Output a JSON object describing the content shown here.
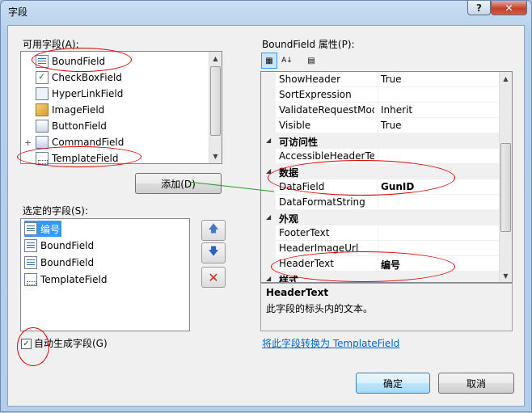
{
  "window": {
    "title": "字段",
    "help_glyph": "?",
    "close_glyph": "✕"
  },
  "available_fields": {
    "label": "可用字段(A):",
    "items": [
      {
        "label": "BoundField",
        "icon": "bound-field-icon"
      },
      {
        "label": "CheckBoxField",
        "icon": "checkbox-field-icon"
      },
      {
        "label": "HyperLinkField",
        "icon": "hyperlink-field-icon"
      },
      {
        "label": "ImageField",
        "icon": "image-field-icon"
      },
      {
        "label": "ButtonField",
        "icon": "button-field-icon"
      },
      {
        "label": "CommandField",
        "icon": "command-field-icon",
        "expand": "+"
      },
      {
        "label": "TemplateField",
        "icon": "template-field-icon"
      }
    ]
  },
  "add_button": {
    "label": "添加(D)"
  },
  "selected_fields": {
    "label": "选定的字段(S):",
    "items": [
      {
        "label": "编号",
        "icon": "bound-field-icon",
        "selected": true
      },
      {
        "label": "BoundField",
        "icon": "bound-field-icon"
      },
      {
        "label": "BoundField",
        "icon": "bound-field-icon"
      },
      {
        "label": "TemplateField",
        "icon": "template-field-icon"
      }
    ]
  },
  "move_buttons": {
    "up": "🡅",
    "down": "🡇",
    "delete": "✕"
  },
  "auto_generate": {
    "label": "自动生成字段(G)",
    "checked": true
  },
  "properties": {
    "label": "BoundField 属性(P):",
    "rows": [
      {
        "type": "prop",
        "name": "ShowHeader",
        "value": "True"
      },
      {
        "type": "prop",
        "name": "SortExpression",
        "value": ""
      },
      {
        "type": "prop",
        "name": "ValidateRequestMode",
        "value": "Inherit"
      },
      {
        "type": "prop",
        "name": "Visible",
        "value": "True"
      },
      {
        "type": "category",
        "name": "可访问性"
      },
      {
        "type": "prop",
        "name": "AccessibleHeaderText",
        "value": ""
      },
      {
        "type": "category",
        "name": "数据"
      },
      {
        "type": "prop",
        "name": "DataField",
        "value": "GunID",
        "bold": true
      },
      {
        "type": "prop",
        "name": "DataFormatString",
        "value": ""
      },
      {
        "type": "category",
        "name": "外观"
      },
      {
        "type": "prop",
        "name": "FooterText",
        "value": ""
      },
      {
        "type": "prop",
        "name": "HeaderImageUrl",
        "value": ""
      },
      {
        "type": "prop",
        "name": "HeaderText",
        "value": "编号",
        "bold": true
      },
      {
        "type": "category",
        "name": "样式"
      }
    ],
    "description_title": "HeaderText",
    "description_text": "此字段的标头内的文本。"
  },
  "convert_link": "将此字段转换为 TemplateField",
  "ok_button": "确定",
  "cancel_button": "取消"
}
